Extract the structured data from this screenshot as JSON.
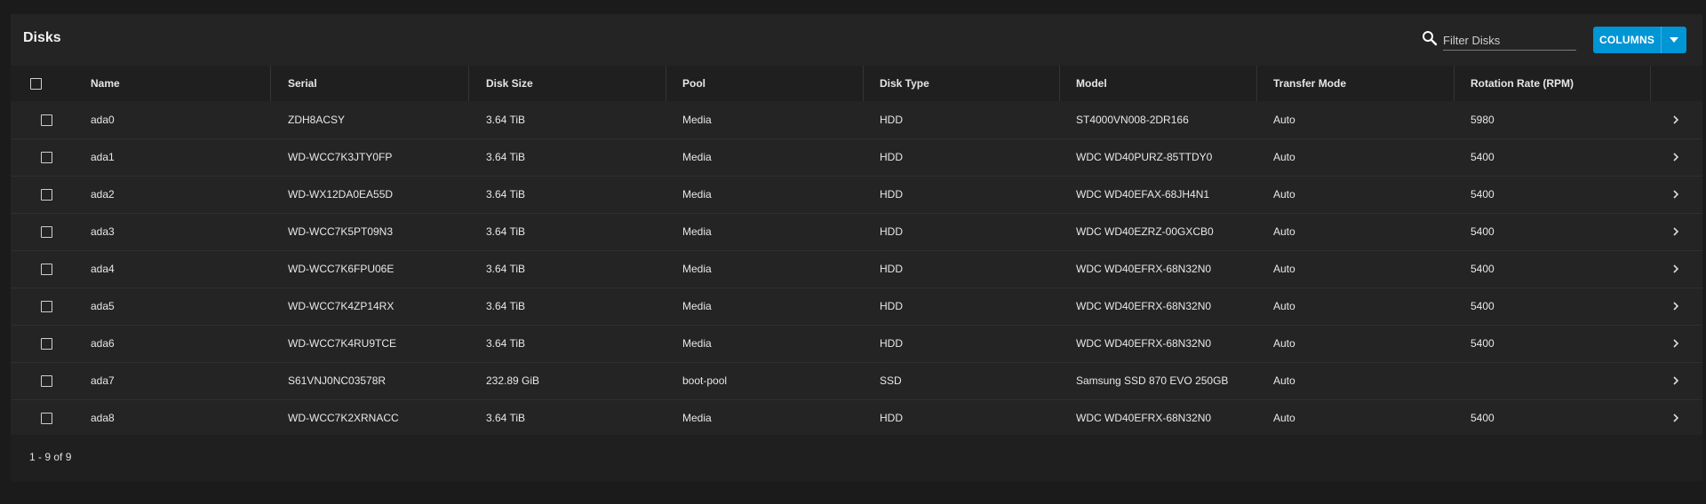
{
  "page": {
    "title": "Disks"
  },
  "filter": {
    "placeholder": "Filter Disks",
    "value": ""
  },
  "toolbar": {
    "columns_label": "COLUMNS"
  },
  "table": {
    "headers": [
      "Name",
      "Serial",
      "Disk Size",
      "Pool",
      "Disk Type",
      "Model",
      "Transfer Mode",
      "Rotation Rate (RPM)"
    ],
    "rows": [
      {
        "name": "ada0",
        "serial": "ZDH8ACSY",
        "size": "3.64 TiB",
        "pool": "Media",
        "type": "HDD",
        "model": "ST4000VN008-2DR166",
        "transfer": "Auto",
        "rpm": "5980"
      },
      {
        "name": "ada1",
        "serial": "WD-WCC7K3JTY0FP",
        "size": "3.64 TiB",
        "pool": "Media",
        "type": "HDD",
        "model": "WDC WD40PURZ-85TTDY0",
        "transfer": "Auto",
        "rpm": "5400"
      },
      {
        "name": "ada2",
        "serial": "WD-WX12DA0EA55D",
        "size": "3.64 TiB",
        "pool": "Media",
        "type": "HDD",
        "model": "WDC WD40EFAX-68JH4N1",
        "transfer": "Auto",
        "rpm": "5400"
      },
      {
        "name": "ada3",
        "serial": "WD-WCC7K5PT09N3",
        "size": "3.64 TiB",
        "pool": "Media",
        "type": "HDD",
        "model": "WDC WD40EZRZ-00GXCB0",
        "transfer": "Auto",
        "rpm": "5400"
      },
      {
        "name": "ada4",
        "serial": "WD-WCC7K6FPU06E",
        "size": "3.64 TiB",
        "pool": "Media",
        "type": "HDD",
        "model": "WDC WD40EFRX-68N32N0",
        "transfer": "Auto",
        "rpm": "5400"
      },
      {
        "name": "ada5",
        "serial": "WD-WCC7K4ZP14RX",
        "size": "3.64 TiB",
        "pool": "Media",
        "type": "HDD",
        "model": "WDC WD40EFRX-68N32N0",
        "transfer": "Auto",
        "rpm": "5400"
      },
      {
        "name": "ada6",
        "serial": "WD-WCC7K4RU9TCE",
        "size": "3.64 TiB",
        "pool": "Media",
        "type": "HDD",
        "model": "WDC WD40EFRX-68N32N0",
        "transfer": "Auto",
        "rpm": "5400"
      },
      {
        "name": "ada7",
        "serial": "S61VNJ0NC03578R",
        "size": "232.89 GiB",
        "pool": "boot-pool",
        "type": "SSD",
        "model": "Samsung SSD 870 EVO 250GB",
        "transfer": "Auto",
        "rpm": ""
      },
      {
        "name": "ada8",
        "serial": "WD-WCC7K2XRNACC",
        "size": "3.64 TiB",
        "pool": "Media",
        "type": "HDD",
        "model": "WDC WD40EFRX-68N32N0",
        "transfer": "Auto",
        "rpm": "5400"
      }
    ]
  },
  "footer": {
    "range": "1 - 9 of 9"
  },
  "colors": {
    "accent": "#0095d5",
    "background": "#1b1b1b",
    "card": "#242424",
    "header_row": "#1f1f1f"
  },
  "icons": {
    "search": "search-icon",
    "caret": "caret-down-icon",
    "expand": "chevron-right-icon"
  }
}
